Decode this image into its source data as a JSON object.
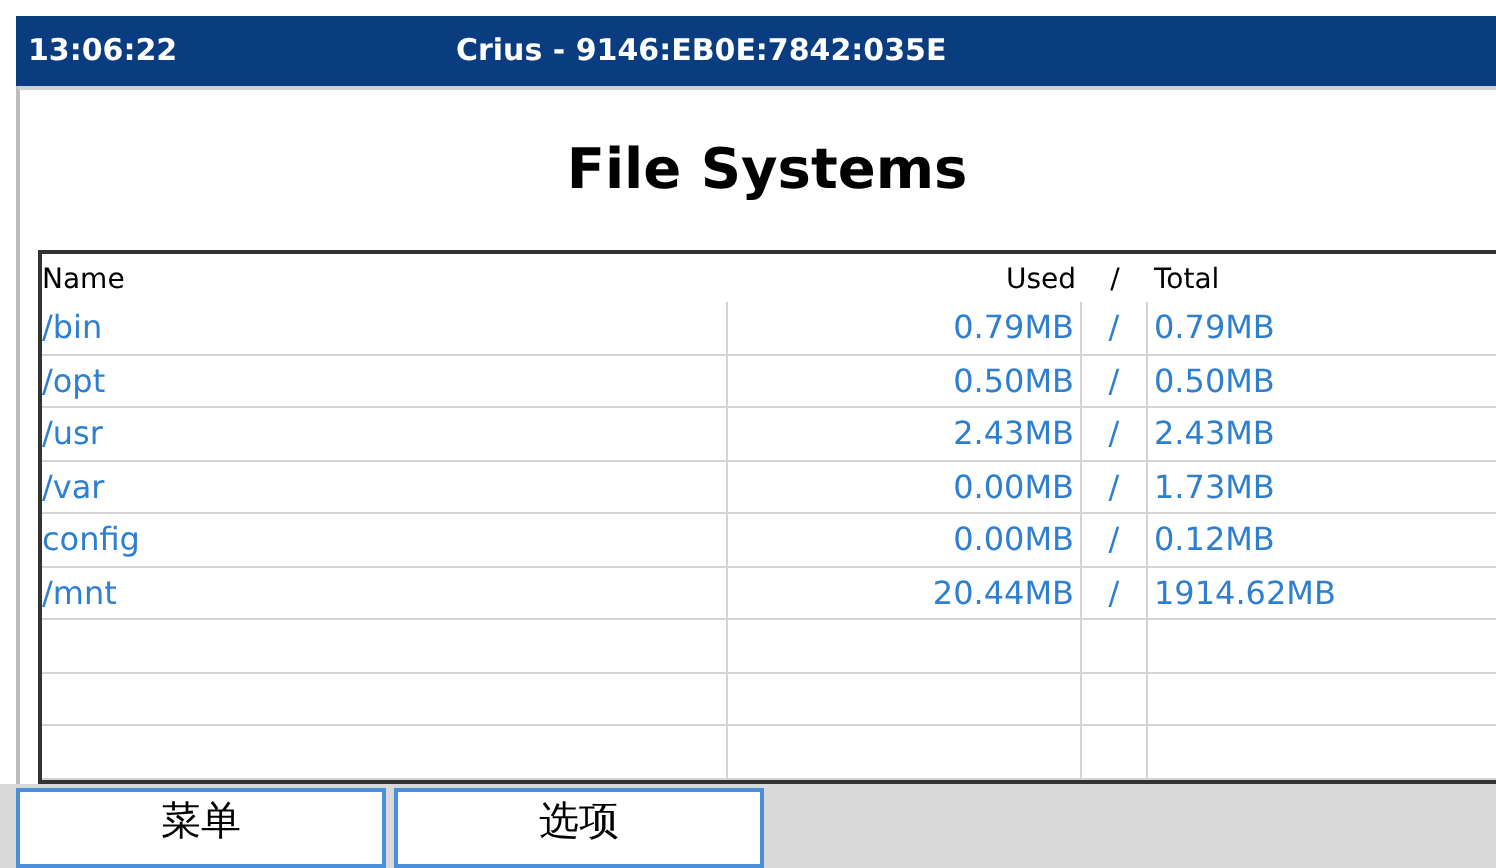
{
  "title_bar": {
    "time": "13:06:22",
    "title": "Crius - 9146:EB0E:7842:035E"
  },
  "heading": "File Systems",
  "table": {
    "columns": [
      "Name",
      "Used",
      "/",
      "Total"
    ],
    "rows": [
      {
        "name": "/bin",
        "used": "0.79MB",
        "separator": "/",
        "total": "0.79MB"
      },
      {
        "name": "/opt",
        "used": "0.50MB",
        "separator": "/",
        "total": "0.50MB"
      },
      {
        "name": "/usr",
        "used": "2.43MB",
        "separator": "/",
        "total": "2.43MB"
      },
      {
        "name": "/var",
        "used": "0.00MB",
        "separator": "/",
        "total": "1.73MB"
      },
      {
        "name": "config",
        "used": "0.00MB",
        "separator": "/",
        "total": "0.12MB"
      },
      {
        "name": "/mnt",
        "used": "20.44MB",
        "separator": "/",
        "total": "1914.62MB"
      }
    ]
  },
  "softkeys": [
    "菜单",
    "选项"
  ]
}
